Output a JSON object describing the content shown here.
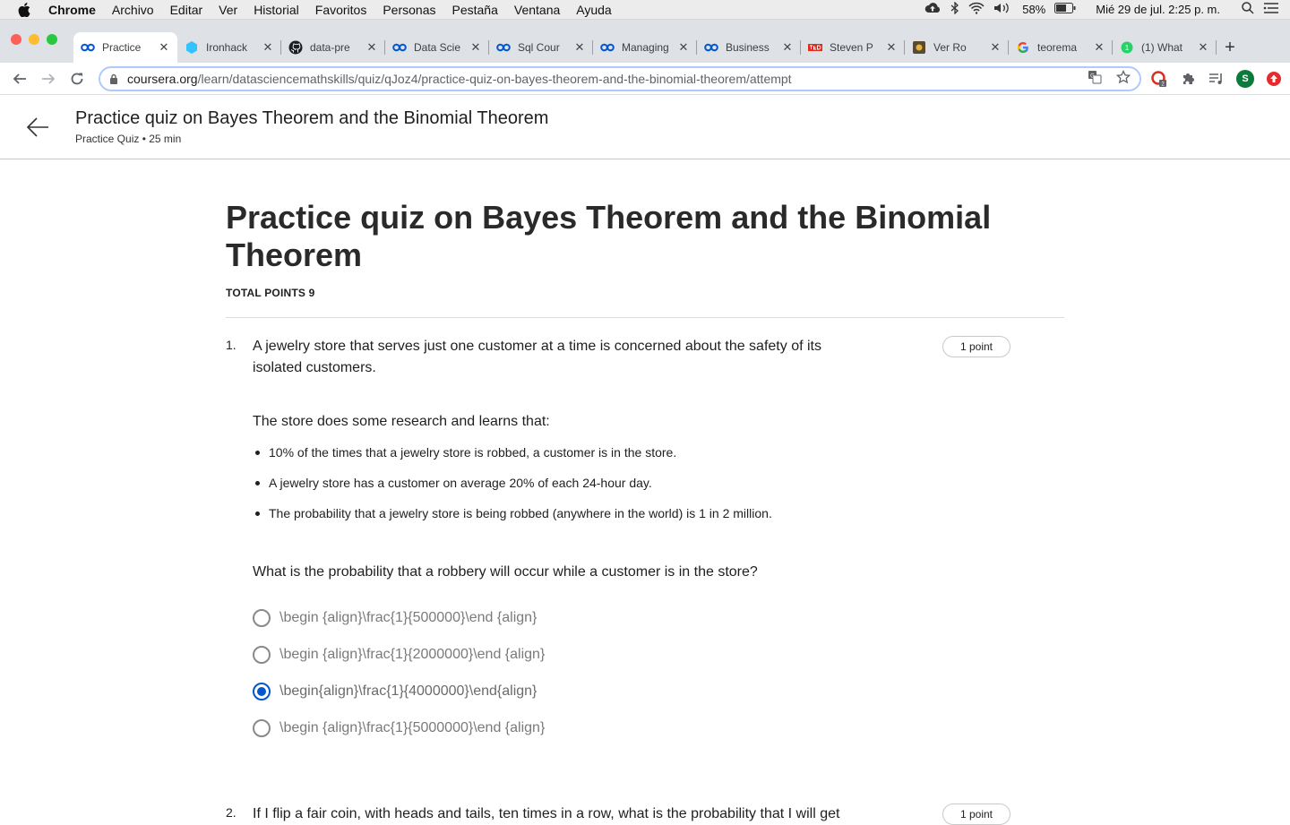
{
  "menubar": {
    "app": "Chrome",
    "items": [
      "Archivo",
      "Editar",
      "Ver",
      "Historial",
      "Favoritos",
      "Personas",
      "Pestaña",
      "Ventana",
      "Ayuda"
    ],
    "battery": "58%",
    "datetime": "Mié 29 de jul.  2:25 p. m."
  },
  "tabs": [
    {
      "title": "Practice",
      "icon": "coursera-icon",
      "active": true
    },
    {
      "title": "Ironhack",
      "icon": "ironhack-icon"
    },
    {
      "title": "data-pre",
      "icon": "github-icon"
    },
    {
      "title": "Data Scie",
      "icon": "coursera-icon"
    },
    {
      "title": "Sql Cour",
      "icon": "coursera-icon"
    },
    {
      "title": "Managing",
      "icon": "coursera-icon"
    },
    {
      "title": "Business",
      "icon": "coursera-icon"
    },
    {
      "title": "Steven P",
      "icon": "ted-icon"
    },
    {
      "title": "Ver Ro",
      "icon": "medal-icon"
    },
    {
      "title": "teorema",
      "icon": "google-icon"
    },
    {
      "title": "(1) What",
      "icon": "whatsapp-icon"
    }
  ],
  "address": {
    "host": "coursera.org",
    "path": "/learn/datasciencemathskills/quiz/qJoz4/practice-quiz-on-bayes-theorem-and-the-binomial-theorem/attempt"
  },
  "header": {
    "title": "Practice quiz on Bayes Theorem and the Binomial Theorem",
    "subtitle": "Practice Quiz • 25 min"
  },
  "quiz": {
    "title": "Practice quiz on Bayes Theorem and the Binomial Theorem",
    "total_points": "TOTAL POINTS 9",
    "questions": [
      {
        "number": "1.",
        "points": "1 point",
        "text": "A jewelry store that serves just one customer at a time is concerned about the safety of its isolated customers.",
        "para": "The store does some research and learns that:",
        "bullets": [
          "10% of the times that a jewelry store is robbed, a customer is in the store.",
          "A jewelry store has a customer on average 20% of each 24-hour day.",
          "The probability that a jewelry store is being robbed (anywhere in the world) is 1 in 2 million."
        ],
        "ask": "What is the probability that a robbery will occur while a customer is in the store?",
        "options": [
          "\\begin {align}\\frac{1}{500000}\\end {align}",
          "\\begin {align}\\frac{1}{2000000}\\end {align}",
          "\\begin{align}\\frac{1}{4000000}\\end{align}",
          "\\begin {align}\\frac{1}{5000000}\\end {align}"
        ],
        "selected": 2
      },
      {
        "number": "2.",
        "points": "1 point",
        "text": "If I flip a fair coin, with heads and tails, ten times in a row, what is the probability that I will get"
      }
    ]
  }
}
